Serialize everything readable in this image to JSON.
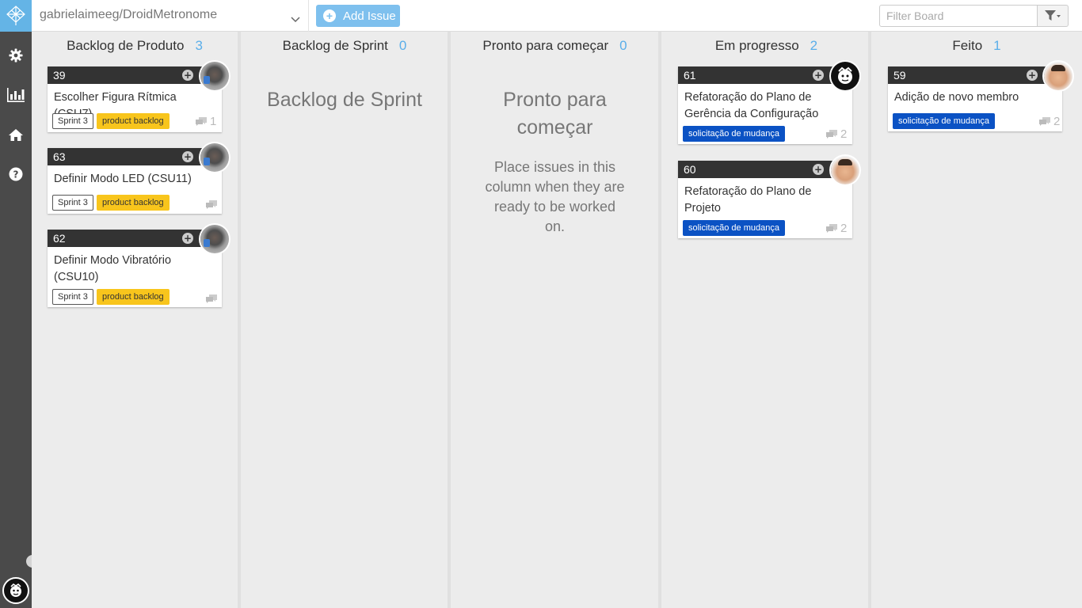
{
  "app": {
    "repo": "gabrielaimeeg/DroidMetronome",
    "add_issue": "Add Issue",
    "filter_placeholder": "Filter Board"
  },
  "sidebar": {
    "items": [
      {
        "icon": "gear-icon"
      },
      {
        "icon": "bar-chart-icon"
      },
      {
        "icon": "home-icon"
      },
      {
        "icon": "help-icon"
      }
    ]
  },
  "columns": [
    {
      "title": "Backlog de Produto",
      "count": "3",
      "cards": [
        {
          "number": "39",
          "title": "Escolher Figura Rítmica (CSU7)",
          "labels": [
            "Sprint 3",
            "product backlog"
          ],
          "comments": "1"
        },
        {
          "number": "63",
          "title": "Definir Modo LED (CSU11)",
          "labels": [
            "Sprint 3",
            "product backlog"
          ],
          "comments": ""
        },
        {
          "number": "62",
          "title": "Definir Modo Vibratório (CSU10)",
          "labels": [
            "Sprint 3",
            "product backlog"
          ],
          "comments": ""
        }
      ]
    },
    {
      "title": "Backlog de Sprint",
      "count": "0",
      "empty_title": "Backlog de Sprint",
      "cards": []
    },
    {
      "title": "Pronto para começar",
      "count": "0",
      "empty_title": "Pronto para começar",
      "empty_text": "Place issues in this column when they are ready to be worked on.",
      "cards": []
    },
    {
      "title": "Em progresso",
      "count": "2",
      "cards": [
        {
          "number": "61",
          "title": "Refatoração do Plano de Gerência da Configuração",
          "labels": [
            "solicitação de mudança"
          ],
          "comments": "2"
        },
        {
          "number": "60",
          "title": "Refatoração do Plano de Projeto",
          "labels": [
            "solicitação de mudança"
          ],
          "comments": "2"
        }
      ]
    },
    {
      "title": "Feito",
      "count": "1",
      "cards": [
        {
          "number": "59",
          "title": "Adição de novo membro",
          "labels": [
            "solicitação de mudança"
          ],
          "comments": "2"
        }
      ]
    }
  ],
  "colors": {
    "sidebar": "#4a4a4a",
    "accent": "#64b4e6",
    "count": "#5aaeea",
    "label_backlog": "#f8c51c",
    "label_change": "#0b52c4",
    "card_header": "#333333"
  }
}
